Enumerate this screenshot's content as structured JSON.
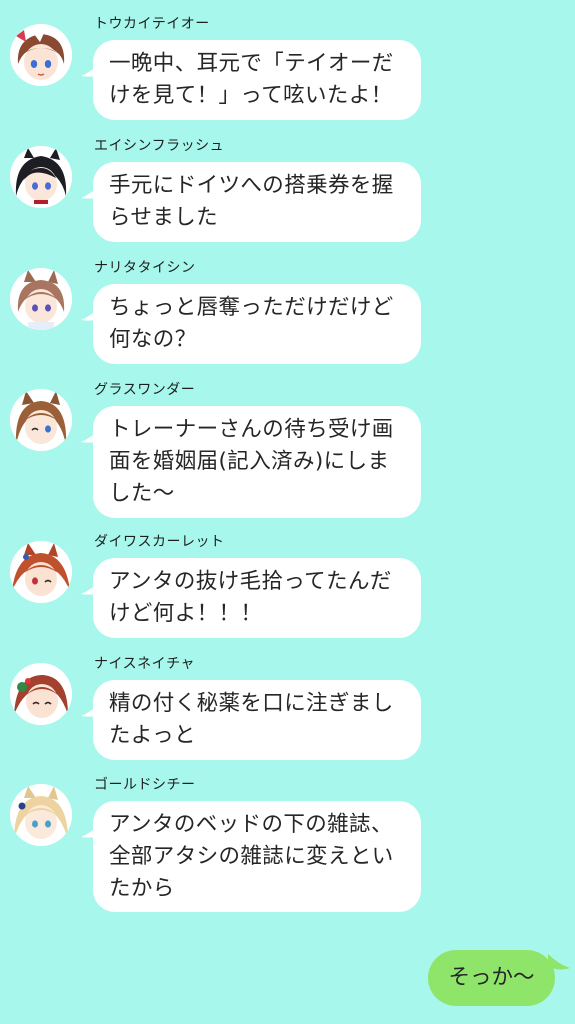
{
  "colors": {
    "background": "#a7f7ec",
    "bubble_in": "#ffffff",
    "bubble_out": "#8ee56a"
  },
  "messages": [
    {
      "sender": "トウカイテイオー",
      "lines": [
        "一晩中、耳元で「テイオーだ",
        "けを見て！」って呟いたよ！"
      ]
    },
    {
      "sender": "エイシンフラッシュ",
      "lines": [
        "手元にドイツへの搭乗券を握",
        "らせました"
      ]
    },
    {
      "sender": "ナリタタイシン",
      "lines": [
        "ちょっと唇奪っただけだけど",
        "何なの？"
      ]
    },
    {
      "sender": "グラスワンダー",
      "lines": [
        "トレーナーさんの待ち受け画",
        "面を婚姻届(記入済み)にしま",
        "した〜"
      ]
    },
    {
      "sender": "ダイワスカーレット",
      "lines": [
        "アンタの抜け毛拾ってたんだ",
        "けど何よ！！！"
      ]
    },
    {
      "sender": "ナイスネイチャ",
      "lines": [
        "精の付く秘薬を口に注ぎまし",
        "たよっと"
      ]
    },
    {
      "sender": "ゴールドシチー",
      "lines": [
        "アンタのベッドの下の雑誌、",
        "全部アタシの雑誌に変えとい",
        "たから"
      ]
    }
  ],
  "reply": {
    "text": "そっか〜"
  }
}
